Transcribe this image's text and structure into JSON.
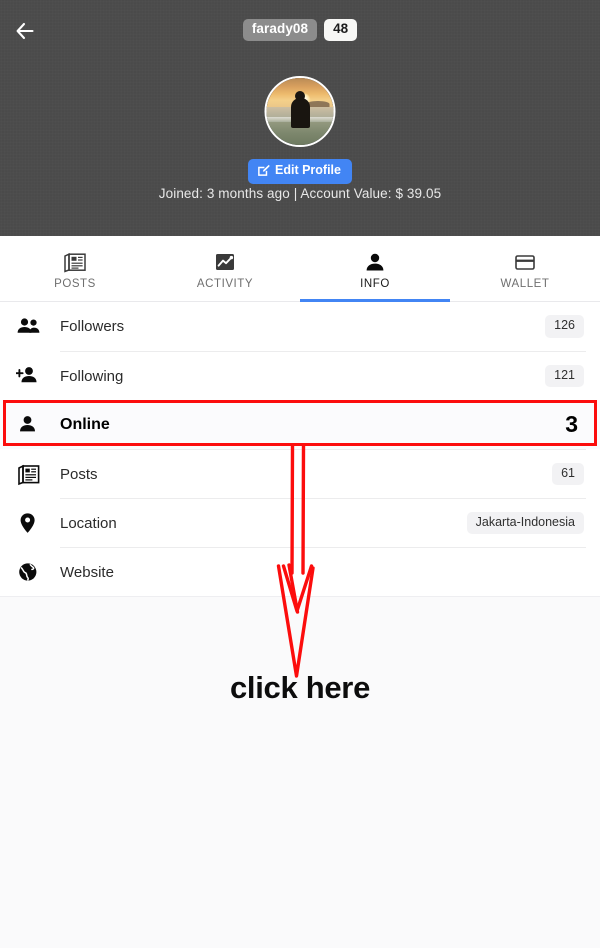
{
  "header": {
    "back_icon": "arrow-left-icon",
    "username_badge": "farady08",
    "count_badge": "48",
    "avatar_alt": "profile-photo-sunset-silhouette",
    "edit_button_label": "Edit Profile",
    "edit_button_icon": "edit-pencil-icon",
    "meta_line": "Joined: 3 months ago |  Account Value: $ 39.05",
    "bg_color": "#4b4b4b",
    "accent_color": "#4285f4"
  },
  "tabs": [
    {
      "label": "POSTS",
      "icon": "newspaper-icon",
      "active": false
    },
    {
      "label": "ACTIVITY",
      "icon": "chart-icon",
      "active": false
    },
    {
      "label": "INFO",
      "icon": "person-icon",
      "active": true
    },
    {
      "label": "WALLET",
      "icon": "card-icon",
      "active": false
    }
  ],
  "info_rows": [
    {
      "label": "Followers",
      "value": "126",
      "icon": "people-icon"
    },
    {
      "label": "Following",
      "value": "121",
      "icon": "person-add-icon"
    },
    {
      "label": "Online",
      "value": "3",
      "icon": "person-icon",
      "highlighted": true
    },
    {
      "label": "Posts",
      "value": "61",
      "icon": "newspaper-icon"
    },
    {
      "label": "Location",
      "value": "Jakarta-Indonesia",
      "icon": "location-pin-icon"
    },
    {
      "label": "Website",
      "value": "",
      "icon": "globe-icon"
    }
  ],
  "annotation": {
    "text": "click here",
    "arrow_icon": "down-arrow-annotation",
    "color": "#fc0d0d"
  }
}
